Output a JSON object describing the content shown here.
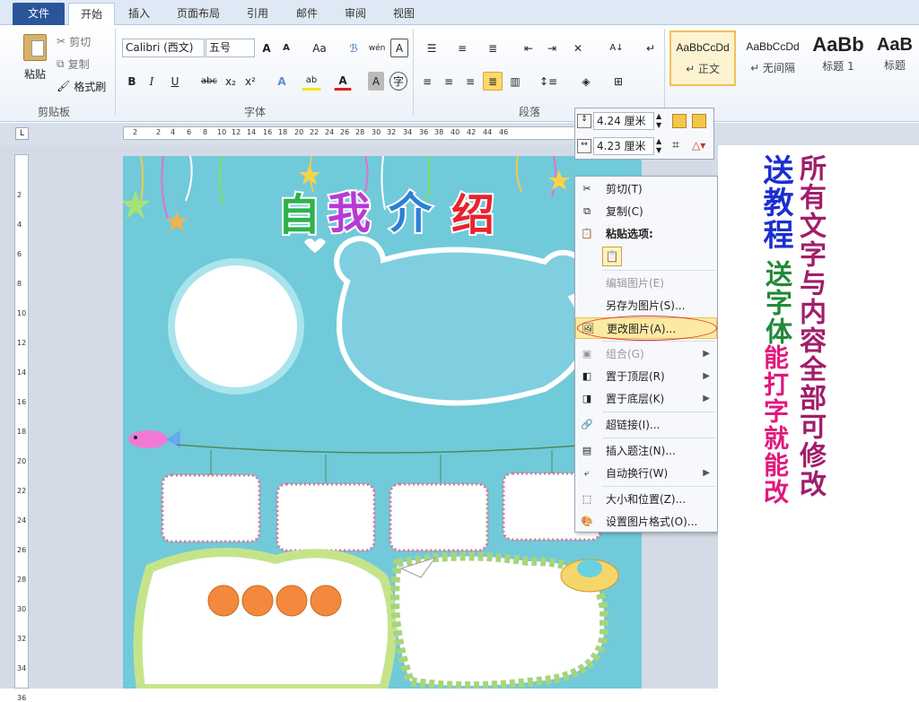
{
  "tabs": [
    "文件",
    "开始",
    "插入",
    "页面布局",
    "引用",
    "邮件",
    "审阅",
    "视图"
  ],
  "clipboard": {
    "paste": "粘贴",
    "cut": "剪切",
    "copy": "复制",
    "format_painter": "格式刷",
    "group": "剪贴板"
  },
  "font": {
    "name": "Calibri (西文)",
    "size": "五号",
    "group": "字体"
  },
  "paragraph": {
    "group": "段落"
  },
  "styles": [
    {
      "sample": "AaBbCcDd",
      "name": "↵ 正文"
    },
    {
      "sample": "AaBbCcDd",
      "name": "↵ 无间隔"
    },
    {
      "sample": "AaBb",
      "name": "标题 1"
    },
    {
      "sample": "AaB",
      "name": "标题"
    }
  ],
  "ruler_ticks": [
    "2",
    "2",
    "4",
    "6",
    "8",
    "10",
    "12",
    "14",
    "16",
    "18",
    "20",
    "22",
    "24",
    "26",
    "28",
    "30",
    "32",
    "34",
    "36",
    "38",
    "40",
    "42",
    "44",
    "46"
  ],
  "vruler_ticks": [
    "2",
    "4",
    "6",
    "8",
    "10",
    "12",
    "14",
    "16",
    "18",
    "20",
    "22",
    "24",
    "26",
    "28",
    "30",
    "32",
    "34",
    "36"
  ],
  "size_box": {
    "height": "4.24 厘米",
    "width": "4.23 厘米"
  },
  "poster": {
    "title": [
      "自",
      "我",
      "介",
      "绍"
    ]
  },
  "context_menu": [
    {
      "label": "剪切(T)",
      "icon": "✂",
      "disabled": false
    },
    {
      "label": "复制(C)",
      "icon": "⧉",
      "disabled": false
    },
    {
      "label": "粘贴选项:",
      "icon": "📋",
      "disabled": false
    },
    {
      "label": "编辑图片(E)",
      "icon": "",
      "disabled": true
    },
    {
      "label": "另存为图片(S)...",
      "icon": "",
      "disabled": false
    },
    {
      "label": "更改图片(A)...",
      "icon": "🖼",
      "disabled": false
    },
    {
      "label": "组合(G)",
      "icon": "▣",
      "disabled": true
    },
    {
      "label": "置于顶层(R)",
      "icon": "◧",
      "disabled": false
    },
    {
      "label": "置于底层(K)",
      "icon": "◨",
      "disabled": false
    },
    {
      "label": "超链接(I)...",
      "icon": "🔗",
      "disabled": false
    },
    {
      "label": "插入题注(N)...",
      "icon": "▤",
      "disabled": false
    },
    {
      "label": "自动换行(W)",
      "icon": "⤶",
      "disabled": false
    },
    {
      "label": "大小和位置(Z)...",
      "icon": "⬚",
      "disabled": false
    },
    {
      "label": "设置图片格式(O)...",
      "icon": "🎨",
      "disabled": false
    }
  ],
  "promo": {
    "left": "送教程",
    "left2": "送字体",
    "middle": "能打字就能改",
    "right": "所有文字与内容全部可修改"
  },
  "colors": {
    "page": "#71cad9",
    "accent": "#2a5699",
    "highlight": "#fce9a2"
  }
}
